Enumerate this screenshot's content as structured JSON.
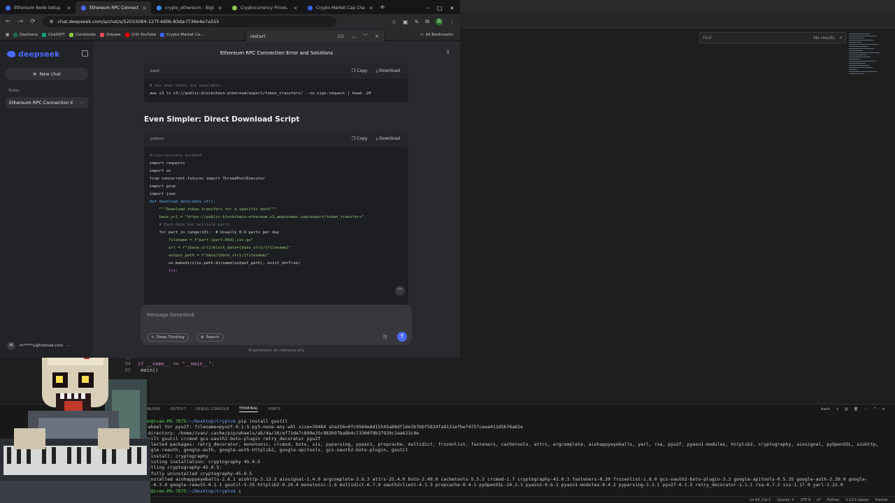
{
  "browser": {
    "tabs": [
      {
        "label": "Ethereum Node Setup",
        "color": "#4d6bfe",
        "active": false
      },
      {
        "label": "Ethereum RPC Connection",
        "color": "#4d6bfe",
        "active": true
      },
      {
        "label": "crypto_ethereum – BigQ",
        "color": "#4285f4",
        "active": false
      },
      {
        "label": "Cryptocurrency Prices, C",
        "color": "#8bc34a",
        "active": false
      },
      {
        "label": "Crypto Market Cap Chart",
        "color": "#3861fb",
        "active": false
      }
    ],
    "new_tab": "+",
    "url": "chat.deepseek.com/a/chat/s/52033084-127f-4d0b-83da-f736e4e7a555",
    "bookmarks": [
      "Dashlane",
      "ChatGPT",
      "CoinGecko",
      "Odysee",
      "(19) YouTube",
      "Crypto Market Ca..."
    ],
    "bookmark_colors": [
      "#1e6b4e",
      "#10a37f",
      "#8dc63f",
      "#e94a57",
      "#ff0000",
      "#3861fb"
    ],
    "all_bookmarks": "All Bookmarks",
    "profile_initial": "G"
  },
  "find": {
    "query": "restart",
    "count": "2/2"
  },
  "deepseek": {
    "brand": "deepseek",
    "new_chat": "New chat",
    "today_label": "Today",
    "chat_item": "Ethereum RPC Connection E",
    "user": "m*****y@hotmail.com",
    "user_initial": "M",
    "title": "Ethereum RPC Connection Error and Solutions",
    "block1": {
      "lang": "bash",
      "copy": "Copy",
      "download": "Download",
      "comment": "# See what dates are available",
      "cmd": "aws s3 ls s3://public-blockchain-ethereum/export/token_transfers/ --no-sign-request | head -20"
    },
    "heading": "Even Simpler: Direct Download Script",
    "block2": {
      "lang": "python",
      "copy": "Copy",
      "download": "Download",
      "lines": [
        "#!/usr/bin/env python3",
        "import requests",
        "import os",
        "from concurrent.futures import ThreadPoolExecutor",
        "import gzip",
        "import json",
        "",
        "def download_date(date_str):",
        "    \"\"\"Download token transfers for a specific date\"\"\"",
        "    base_url = \"https://public-blockchain-ethereum.s3.amazonaws.com/export/token_transfers\"",
        "",
        "    # Each date has multiple parts",
        "    for part in range(10):  # Usually 0-9 parts per day",
        "        filename = f\"part-{part:05d}.csv.gz\"",
        "        url = f\"{base_url}/block_date={date_str}/{filename}\"",
        "        output_path = f\"data/{date_str}/{filename}\"",
        "",
        "        os.makedirs(os.path.dirname(output_path), exist_ok=True)",
        "",
        "        try:"
      ]
    },
    "composer_placeholder": "Message DeepSeek",
    "deep_thinking": "Deep Thinking",
    "search": "Search",
    "disclaimer": "AI-generated, for reference only"
  },
  "editor": {
    "find_placeholder": "Find",
    "find_result": "No results",
    "lines": [
      {
        "num": "93",
        "text": ""
      },
      {
        "num": "94",
        "text": "if __name__ == \"__main__\":"
      },
      {
        "num": "95",
        "text": "    main()"
      }
    ]
  },
  "terminal": {
    "tabs": [
      "PROBLEMS",
      "OUTPUT",
      "DEBUG CONSOLE",
      "TERMINAL",
      "PORTS"
    ],
    "active_tab": "TERMINAL",
    "shell": "bash",
    "prompt_user": "ivan@ivan-MS-7D75",
    "prompt_path": ":~/Desktop/Crypto$",
    "command": " pip install gsutil",
    "output": [
      "ed wheel for pyu2f: filename=pyu2f-0.1.5-py3-none-any.whl size=39484 sha256=0fc9564e6d15545a88df16e3b7bbf5824fa9131efbe74757ceea411d5b76a62e",
      "in directory: /home/ivan/.cache/pip/wheels/ab/4a/10/ef71de7c899e25c982b97ba8b4c7330df9b37929c2aa623c9e",
      "y built gsutil crcmod gcs-oauth2-boto-plugin retry_decorator pyu2f",
      " collected packages: retry_decorator, monotonic, crcmod, boto, six, pyparsing, pyasn1, propcache, multidict, frozenlist, fasteners, cachetools, attrs, argcomplete, aiohappyeyeballs, yarl, rsa, pyu2f, pyasn1-modules, httplib2, cryptography, aiosignal, pyOpenSSL, aiohttp,",
      " google-reauth, google-auth, google-auth-httplib2, google-apitools, gcs-oauth2-boto-plugin, gsutil",
      "ing install: cryptography",
      "d existing installation: cryptography 45.0.5",
      "nstalling cryptography-45.0.5:",
      "cessfully uninstalled cryptography-45.0.5",
      "ly installed aiohappyeyeballs-2.6.1 aiohttp-3.13.3 aiosignal-1.4.0 argcomplete-3.6.3 attrs-25.4.0 boto-2.49.0 cachetools-5.5.2 crcmod-1.7 cryptography-43.0.3 fasteners-0.20 frozenlist-1.8.0 gcs-oauth2-boto-plugin-3.3 google-apitools-0.5.35 google-auth-2.39.0 google-",
      "lib2-0.3.0 google-reauth-0.1.1 gsutil-5.35 httplib2-0.20.4 monotonic-1.6 multidict-6.7.0 oauth2client-4.1.3 propcache-0.4.1 pyOpenSSL-24.2.1 pyasn1-0.6.1 pyasn1-modules-0.4.2 pyparsing-3.3.1 pyu2f-0.1.5 retry_decorator-1.1.1 rsa-4.7.2 six-1.17.0 yarl-1.22.0"
    ]
  },
  "status": {
    "position": "Ln 93, Col 1",
    "spaces": "Spaces: 4",
    "encoding": "UTF-8",
    "eol": "LF",
    "language": "Python",
    "interpreter": "3.13.5 (base)",
    "formatter": "Prettier"
  }
}
